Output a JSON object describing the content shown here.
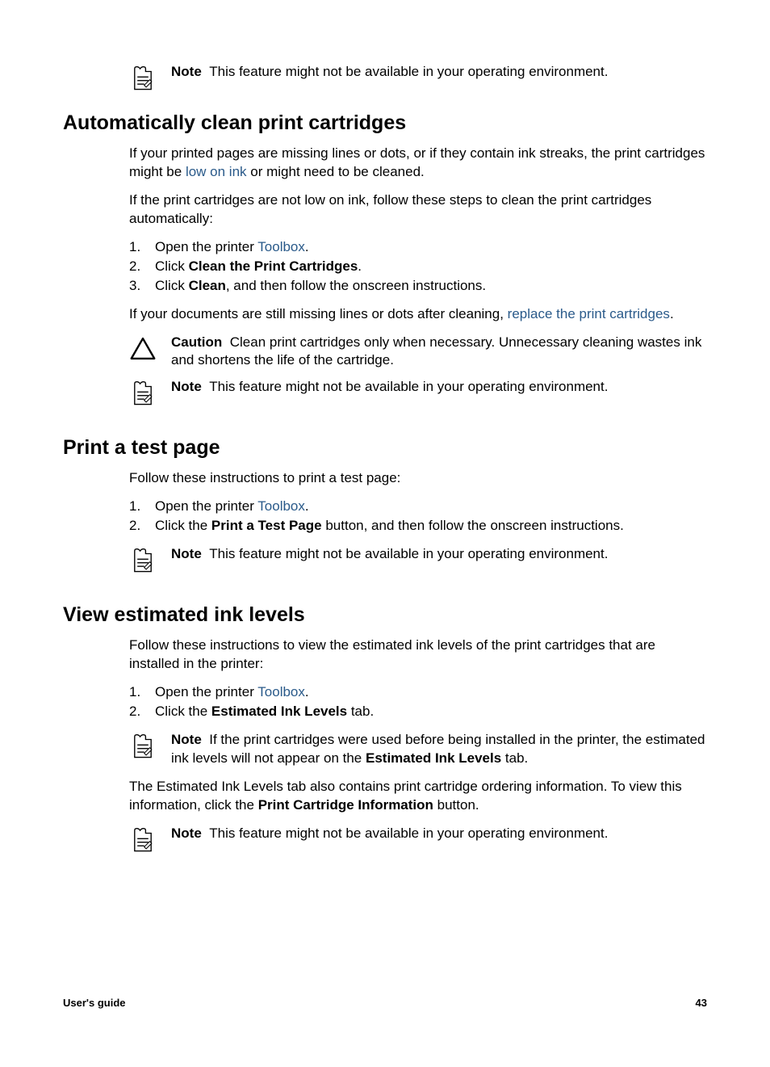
{
  "note_generic": {
    "label": "Note",
    "text": "This feature might not be available in your operating environment."
  },
  "section1": {
    "heading": "Automatically clean print cartridges",
    "para1_a": "If your printed pages are missing lines or dots, or if they contain ink streaks, the print cartridges might be ",
    "para1_link": "low on ink",
    "para1_b": " or might need to be cleaned.",
    "para2": "If the print cartridges are not low on ink, follow these steps to clean the print cartridges automatically:",
    "steps": {
      "s1_a": "Open the printer ",
      "s1_link": "Toolbox",
      "s1_b": ".",
      "s2_a": "Click ",
      "s2_bold": "Clean the Print Cartridges",
      "s2_b": ".",
      "s3_a": "Click ",
      "s3_bold": "Clean",
      "s3_b": ", and then follow the onscreen instructions."
    },
    "para3_a": "If your documents are still missing lines or dots after cleaning, ",
    "para3_link": "replace the print cartridges",
    "para3_b": ".",
    "caution": {
      "label": "Caution",
      "text": "Clean print cartridges only when necessary. Unnecessary cleaning wastes ink and shortens the life of the cartridge."
    }
  },
  "section2": {
    "heading": "Print a test page",
    "para1": "Follow these instructions to print a test page:",
    "steps": {
      "s1_a": "Open the printer ",
      "s1_link": "Toolbox",
      "s1_b": ".",
      "s2_a": "Click the ",
      "s2_bold": "Print a Test Page",
      "s2_b": " button, and then follow the onscreen instructions."
    }
  },
  "section3": {
    "heading": "View estimated ink levels",
    "para1": "Follow these instructions to view the estimated ink levels of the print cartridges that are installed in the printer:",
    "steps": {
      "s1_a": "Open the printer ",
      "s1_link": "Toolbox",
      "s1_b": ".",
      "s2_a": "Click the ",
      "s2_bold": "Estimated Ink Levels",
      "s2_b": " tab."
    },
    "note1": {
      "label": "Note",
      "text_a": "If the print cartridges were used before being installed in the printer, the estimated ink levels will not appear on the ",
      "text_bold": "Estimated Ink Levels",
      "text_b": " tab."
    },
    "para2_a": "The Estimated Ink Levels tab also contains print cartridge ordering information. To view this information, click the ",
    "para2_bold": "Print Cartridge Information",
    "para2_b": " button."
  },
  "footer": {
    "left": "User's guide",
    "right": "43"
  }
}
